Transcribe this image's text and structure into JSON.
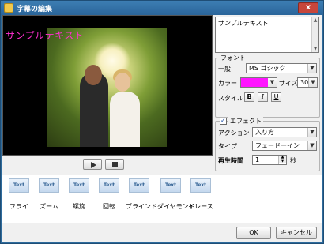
{
  "window": {
    "title": "字幕の編集",
    "close_label": "x"
  },
  "preview": {
    "overlay_text": "サンプルテキスト"
  },
  "text_editor": {
    "value": "サンプルテキスト"
  },
  "font": {
    "legend": "フォント",
    "family_label": "一般",
    "family_value": "MS ゴシック",
    "color_label": "カラー",
    "color_value": "#ff14ff",
    "size_label": "サイズ",
    "size_value": "30",
    "style_label": "スタイル",
    "bold": "B",
    "italic": "I",
    "underline": "U"
  },
  "effect": {
    "legend": "エフェクト",
    "action_label": "アクション",
    "action_value": "入り方",
    "type_label": "タイプ",
    "type_value": "フェードーイン",
    "duration_label": "再生時間",
    "duration_value": "1",
    "duration_unit": "秒"
  },
  "effects_list": [
    {
      "label": "フライ",
      "icon": "Text"
    },
    {
      "label": "ズーム",
      "icon": "Text"
    },
    {
      "label": "螺旋",
      "icon": "Text"
    },
    {
      "label": "回転",
      "icon": "Text"
    },
    {
      "label": "ブラインド",
      "icon": "Text"
    },
    {
      "label": "ダイヤモンド",
      "icon": "Text"
    },
    {
      "label": "イレース",
      "icon": "Text"
    }
  ],
  "footer": {
    "ok_label": "OK",
    "cancel_label": "キャンセル"
  }
}
